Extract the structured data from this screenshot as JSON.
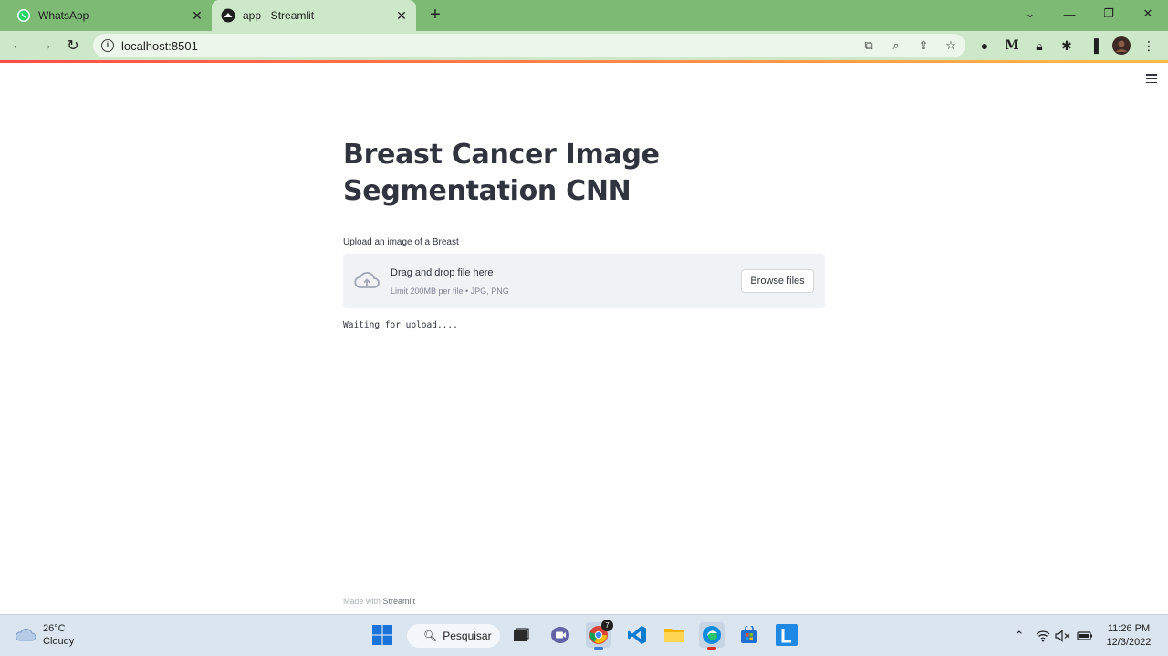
{
  "browser": {
    "tabs": [
      {
        "title": "WhatsApp",
        "icon": "whatsapp-icon",
        "active": false
      },
      {
        "title": "app · Streamlit",
        "icon": "streamlit-icon",
        "active": true
      }
    ],
    "url": "localhost:8501",
    "accent_color": "#7dbb75"
  },
  "page": {
    "title": "Breast Cancer Image Segmentation CNN",
    "uploader": {
      "label": "Upload an image of a Breast",
      "drop_text": "Drag and drop file here",
      "limit_text": "Limit 200MB per file • JPG, PNG",
      "button_label": "Browse files"
    },
    "status_text": "Waiting for upload....",
    "footer": {
      "prefix": "Made with ",
      "brand": "Streamlit"
    }
  },
  "taskbar": {
    "weather": {
      "temp": "26°C",
      "condition": "Cloudy"
    },
    "search_label": "Pesquisar",
    "chrome_badge": "7",
    "clock": {
      "time": "11:26 PM",
      "date": "12/3/2022"
    }
  }
}
